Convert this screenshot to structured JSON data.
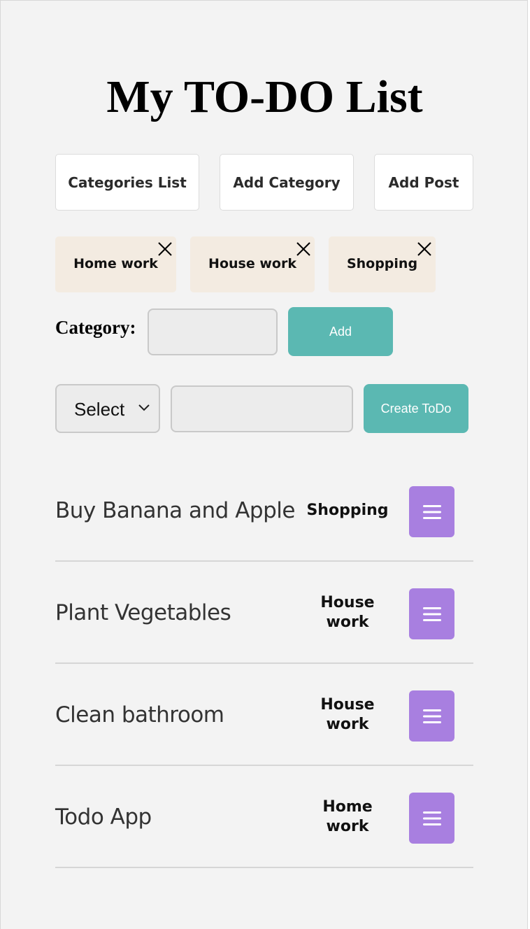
{
  "page": {
    "title": "My TO-DO List"
  },
  "nav": {
    "categories_list": "Categories List",
    "add_category": "Add Category",
    "add_post": "Add Post"
  },
  "categories": [
    {
      "label": "Home work"
    },
    {
      "label": "House work"
    },
    {
      "label": "Shopping"
    }
  ],
  "category_form": {
    "label": "Category:",
    "input_value": "",
    "button_label": "Add"
  },
  "todo_form": {
    "select_value": "Select",
    "input_value": "",
    "button_label": "Create ToDo"
  },
  "todos": [
    {
      "title": "Buy Banana and Apple",
      "category": "Shopping"
    },
    {
      "title": "Plant Vegetables",
      "category": "House work"
    },
    {
      "title": "Clean bathroom",
      "category": "House work"
    },
    {
      "title": "Todo App",
      "category": "Home work"
    }
  ],
  "colors": {
    "background": "#f3f3f3",
    "chip": "#f3ebe1",
    "accent_teal": "#5bb8b2",
    "menu_purple": "#a87fe0"
  },
  "icons": {
    "chip_close": "close-icon",
    "select_arrow": "chevron-down-icon",
    "todo_menu": "menu-icon"
  }
}
